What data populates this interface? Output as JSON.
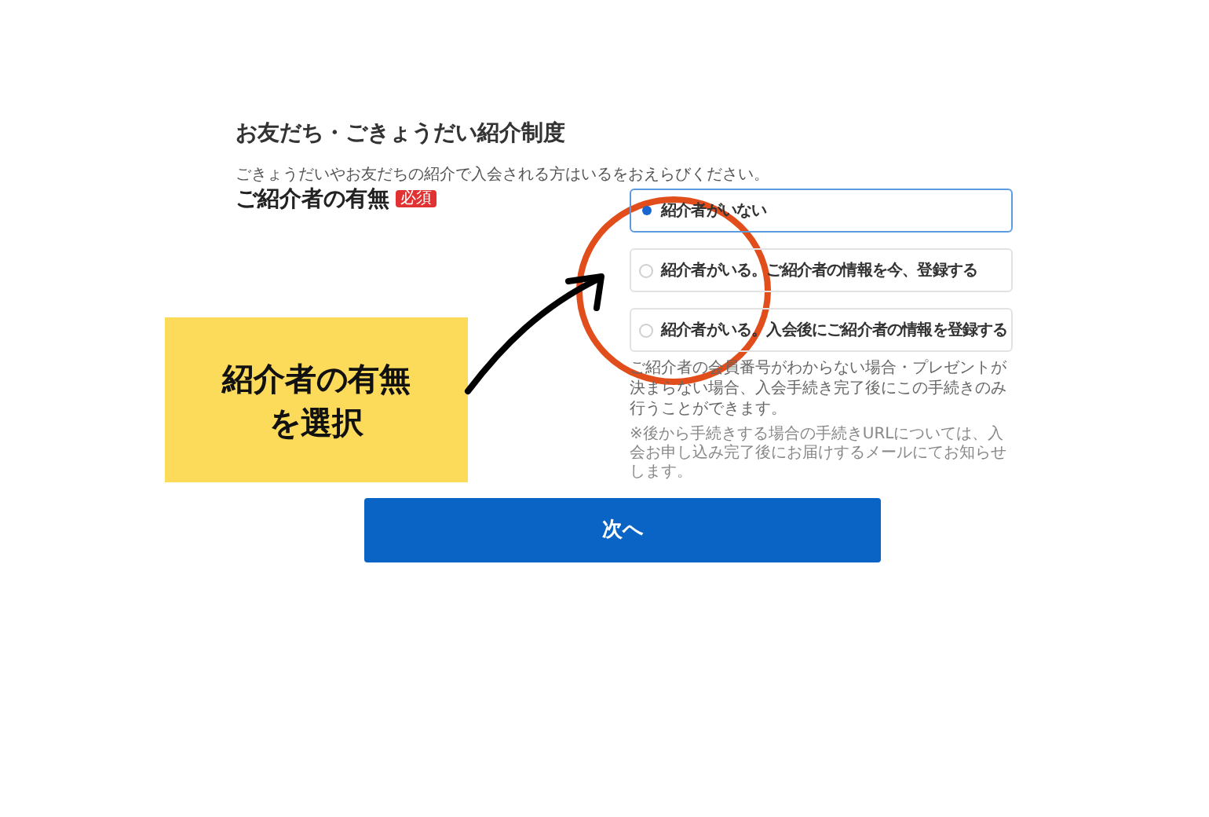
{
  "title": "お友だち・ごきょうだい紹介制度",
  "description": "ごきょうだいやお友だちの紹介で入会される方はいるをおえらびください。",
  "field": {
    "label": "ご紹介者の有無",
    "required_badge": "必須",
    "options": [
      {
        "label": "紹介者がいない",
        "selected": true
      },
      {
        "label": "紹介者がいる。ご紹介者の情報を今、登録する",
        "selected": false
      },
      {
        "label": "紹介者がいる。入会後にご紹介者の情報を登録する",
        "selected": false
      }
    ],
    "help": "ご紹介者の会員番号がわからない場合・プレゼントが決まらない場合、入会手続き完了後にこの手続きのみ行うことができます。",
    "note": "※後から手続きする場合の手続きURLについては、入会お申し込み完了後にお届けするメールにてお知らせします。"
  },
  "next_button": "次へ",
  "annotation": {
    "callout_lines": [
      "紹介者の有無",
      "を選択"
    ]
  }
}
